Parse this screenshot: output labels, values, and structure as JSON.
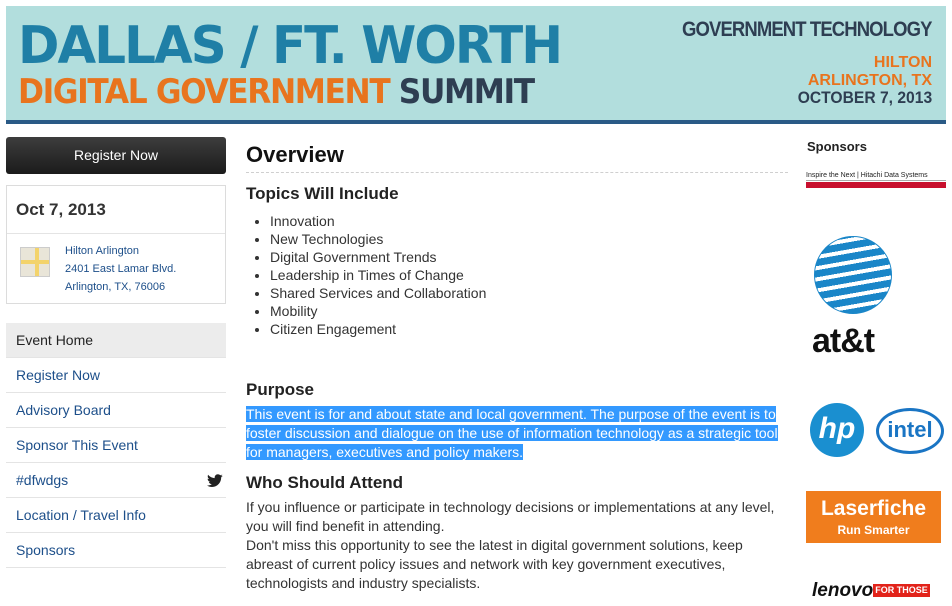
{
  "banner": {
    "line1": "DALLAS / FT. WORTH",
    "line2_a": "DIGITAL GOVERNMENT",
    "line2_b": "SUMMIT",
    "brand": "GOVERNMENT TECHNOLOGY",
    "venue_1": "HILTON",
    "venue_2": "ARLINGTON, TX",
    "date": "OCTOBER 7, 2013",
    "colors": {
      "background": "#b2dedd",
      "blue": "#1f7fa6",
      "orange": "#e8741e",
      "dark": "#2e3e52"
    }
  },
  "sidebar": {
    "register_label": "Register Now",
    "event_date": "Oct 7, 2013",
    "address": {
      "line1": "Hilton Arlington",
      "line2": "2401 East Lamar Blvd.",
      "line3": "Arlington, TX, 76006"
    },
    "nav": [
      {
        "label": "Event Home",
        "active": true
      },
      {
        "label": "Register Now"
      },
      {
        "label": "Advisory Board"
      },
      {
        "label": "Sponsor This Event"
      },
      {
        "label": "#dfwdgs",
        "icon": "twitter-bird-icon"
      },
      {
        "label": "Location / Travel Info"
      },
      {
        "label": "Sponsors"
      }
    ]
  },
  "main": {
    "title": "Overview",
    "topics_heading": "Topics Will Include",
    "topics": [
      "Innovation",
      "New Technologies",
      "Digital Government Trends",
      "Leadership in Times of Change",
      "Shared Services and Collaboration",
      "Mobility",
      "Citizen Engagement"
    ],
    "purpose_heading": "Purpose",
    "purpose_text": "This event is for and about state and local government. The purpose of the event is to foster discussion and dialogue on the use of information technology as a strategic tool for managers, executives and policy makers.",
    "who_heading": "Who Should Attend",
    "who_text_1": "If you influence or participate in technology decisions or implementations at any level, you will find benefit in attending.",
    "who_text_2": "Don't miss this opportunity to see the latest in digital government solutions, keep abreast of current policy issues and network with key government executives, technologists and industry specialists."
  },
  "sponsors": {
    "heading": "Sponsors",
    "hitachi_text": "Inspire the Next | Hitachi Data Systems",
    "att": "at&t",
    "hp": "hp",
    "intel": "intel",
    "laserfiche_1": "Laserfiche",
    "laserfiche_2": "Run Smarter",
    "lenovo": "lenovo",
    "lenovo_tag": "FOR THOSE"
  }
}
